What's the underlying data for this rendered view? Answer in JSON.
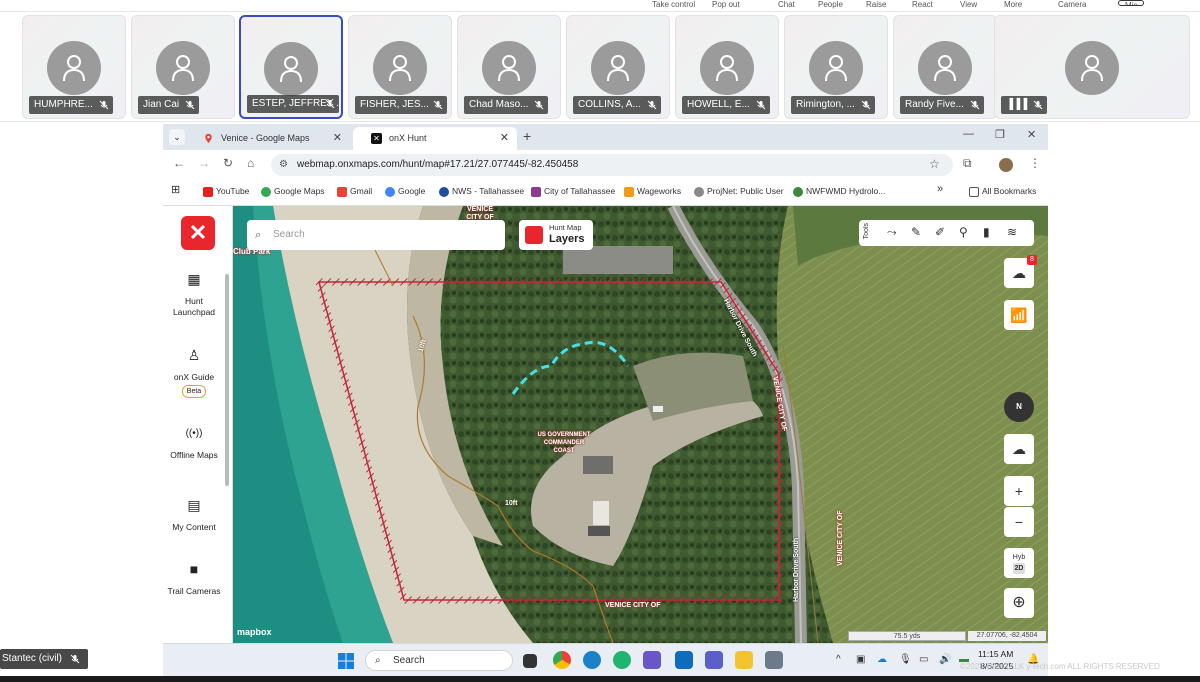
{
  "meeting_toolbar": {
    "items": [
      "Take control",
      "Pop out",
      "Chat",
      "People",
      "Raise",
      "React",
      "View",
      "More",
      "Camera",
      "Mic"
    ]
  },
  "participants": [
    {
      "name": "HUMPHRE...",
      "muted": true
    },
    {
      "name": "Jian Cai",
      "muted": true
    },
    {
      "name": "ESTEP, JEFFREY ...",
      "muted": false,
      "selected": true
    },
    {
      "name": "FISHER, JES...",
      "muted": true
    },
    {
      "name": "Chad Maso...",
      "muted": true
    },
    {
      "name": "COLLINS, A...",
      "muted": true
    },
    {
      "name": "HOWELL, E...",
      "muted": true
    },
    {
      "name": "Rimington, ...",
      "muted": true
    },
    {
      "name": "Randy Five...",
      "muted": true
    },
    {
      "name": "",
      "muted": true,
      "speaking_icon": true
    }
  ],
  "browser": {
    "tabs": [
      {
        "title": "Venice - Google Maps",
        "active": false
      },
      {
        "title": "onX Hunt",
        "active": true
      }
    ],
    "url": "webmap.onxmaps.com/hunt/map#17.21/27.077445/-82.450458",
    "bookmarks": [
      "YouTube",
      "Google Maps",
      "Gmail",
      "Google",
      "NWS - Tallahassee",
      "City of Tallahassee",
      "Wageworks",
      "ProjNet: Public User",
      "NWFWMD Hydrolo..."
    ],
    "all_bookmarks": "All Bookmarks"
  },
  "onx": {
    "logo": "✕",
    "sidebar": [
      {
        "label": "Hunt Launchpad",
        "icon": "grid-icon"
      },
      {
        "label": "onX Guide",
        "icon": "guide-icon",
        "badge": "Beta"
      },
      {
        "label": "Offline Maps",
        "icon": "offline-icon"
      },
      {
        "label": "My Content",
        "icon": "content-icon"
      },
      {
        "label": "Trail Cameras",
        "icon": "camera-icon"
      }
    ],
    "search_placeholder": "Search",
    "layers": {
      "small": "Hunt Map",
      "big": "Layers"
    },
    "tools_label": "Tools",
    "badge_count": "8",
    "compass": "N",
    "zoom_in": "+",
    "zoom_out": "−",
    "hyb": "Hyb",
    "mode": "2D",
    "mapbox": "mapbox",
    "scale": "75.5 yds",
    "coords": "27.07706, -82.4504",
    "labels": {
      "venice_city_of_bottom": "VENICE CITY OF",
      "venice_city_of_top": "VENICE CITY OF",
      "venice_city_of_right1": "VENICE CITY OF",
      "venice_city_of_right2": "VENICE CITY OF",
      "harbor_drive_1": "Harbor Drive South",
      "harbor_drive_2": "Harbor Drive South",
      "club_park": "Club Park",
      "contour_10ft_1": "10ft",
      "contour_10ft_2": "10ft",
      "gov": "US GOVERNMENT COMMANDER COAST"
    }
  },
  "taskbar": {
    "search": "Search",
    "time": "11:15 AM",
    "date": "8/6/2025"
  },
  "stantec": "Stantec (civil)",
  "watermark": "©2025 Tech TALK y-tech.com ALL RIGHTS RESERVED"
}
